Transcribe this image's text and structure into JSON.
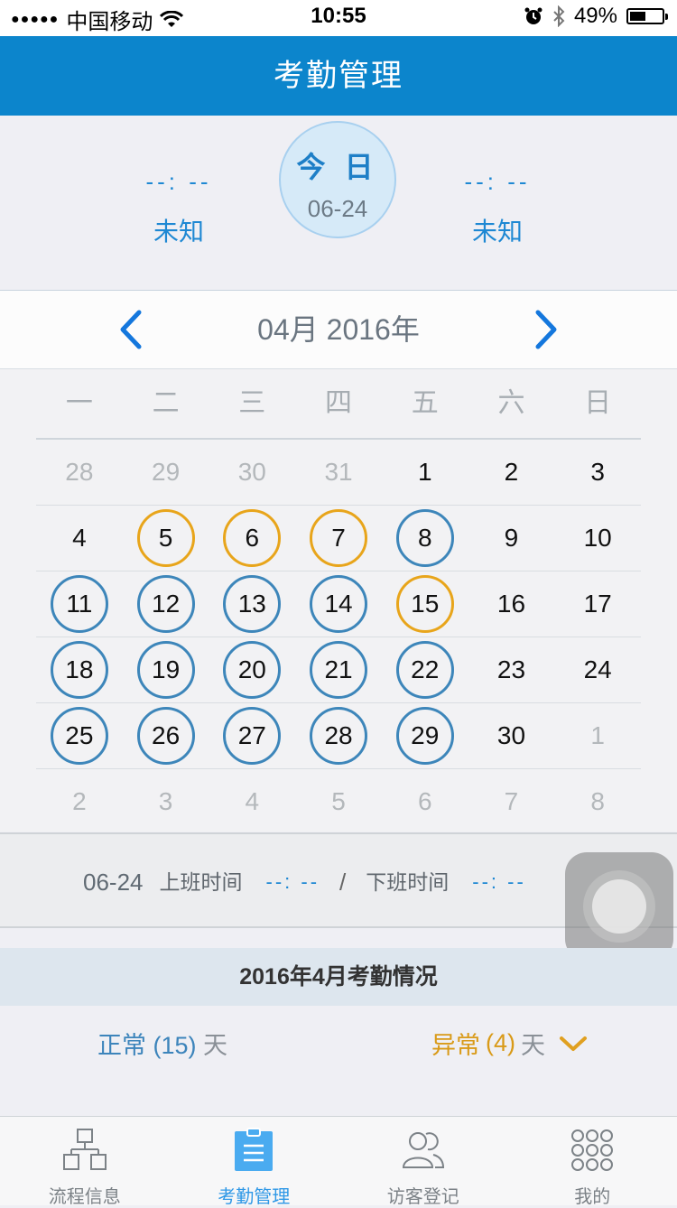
{
  "status_bar": {
    "signal_dots": "●●●●●",
    "carrier": "中国移动",
    "time": "10:55",
    "battery_percent": "49%",
    "battery_level": 0.49
  },
  "nav": {
    "title": "考勤管理"
  },
  "today_panel": {
    "left_time": "--: --",
    "left_status": "未知",
    "today_label": "今 日",
    "today_date": "06-24",
    "right_time": "--: --",
    "right_status": "未知"
  },
  "month_header": {
    "title": "04月 2016年"
  },
  "calendar": {
    "weekdays": [
      "一",
      "二",
      "三",
      "四",
      "五",
      "六",
      "日"
    ],
    "weeks": [
      [
        {
          "d": "28",
          "m": "other"
        },
        {
          "d": "29",
          "m": "other"
        },
        {
          "d": "30",
          "m": "other"
        },
        {
          "d": "31",
          "m": "other"
        },
        {
          "d": "1",
          "m": "cur"
        },
        {
          "d": "2",
          "m": "cur"
        },
        {
          "d": "3",
          "m": "cur"
        }
      ],
      [
        {
          "d": "4",
          "m": "cur"
        },
        {
          "d": "5",
          "m": "cur",
          "s": "abnormal"
        },
        {
          "d": "6",
          "m": "cur",
          "s": "abnormal"
        },
        {
          "d": "7",
          "m": "cur",
          "s": "abnormal"
        },
        {
          "d": "8",
          "m": "cur",
          "s": "normal"
        },
        {
          "d": "9",
          "m": "cur"
        },
        {
          "d": "10",
          "m": "cur"
        }
      ],
      [
        {
          "d": "11",
          "m": "cur",
          "s": "normal"
        },
        {
          "d": "12",
          "m": "cur",
          "s": "normal"
        },
        {
          "d": "13",
          "m": "cur",
          "s": "normal"
        },
        {
          "d": "14",
          "m": "cur",
          "s": "normal"
        },
        {
          "d": "15",
          "m": "cur",
          "s": "abnormal"
        },
        {
          "d": "16",
          "m": "cur"
        },
        {
          "d": "17",
          "m": "cur"
        }
      ],
      [
        {
          "d": "18",
          "m": "cur",
          "s": "normal"
        },
        {
          "d": "19",
          "m": "cur",
          "s": "normal"
        },
        {
          "d": "20",
          "m": "cur",
          "s": "normal"
        },
        {
          "d": "21",
          "m": "cur",
          "s": "normal"
        },
        {
          "d": "22",
          "m": "cur",
          "s": "normal"
        },
        {
          "d": "23",
          "m": "cur"
        },
        {
          "d": "24",
          "m": "cur"
        }
      ],
      [
        {
          "d": "25",
          "m": "cur",
          "s": "normal"
        },
        {
          "d": "26",
          "m": "cur",
          "s": "normal"
        },
        {
          "d": "27",
          "m": "cur",
          "s": "normal"
        },
        {
          "d": "28",
          "m": "cur",
          "s": "normal"
        },
        {
          "d": "29",
          "m": "cur",
          "s": "normal"
        },
        {
          "d": "30",
          "m": "cur"
        },
        {
          "d": "1",
          "m": "other"
        }
      ],
      [
        {
          "d": "2",
          "m": "other"
        },
        {
          "d": "3",
          "m": "other"
        },
        {
          "d": "4",
          "m": "other"
        },
        {
          "d": "5",
          "m": "other"
        },
        {
          "d": "6",
          "m": "other"
        },
        {
          "d": "7",
          "m": "other"
        },
        {
          "d": "8",
          "m": "other"
        }
      ]
    ]
  },
  "day_detail": {
    "date": "06-24",
    "checkin_label": "上班时间",
    "checkin_value": "--: --",
    "separator": "/",
    "checkout_label": "下班时间",
    "checkout_value": "--: --"
  },
  "summary": {
    "title": "2016年4月考勤情况",
    "normal_label": "正常",
    "normal_count": "(15)",
    "abnormal_label": "异常",
    "abnormal_count": "(4)",
    "unit": "天"
  },
  "tabs": [
    {
      "label": "流程信息",
      "icon": "flowchart-icon"
    },
    {
      "label": "考勤管理",
      "icon": "clipboard-icon",
      "active": true
    },
    {
      "label": "访客登记",
      "icon": "visitors-icon"
    },
    {
      "label": "我的",
      "icon": "grid-dots-icon"
    }
  ],
  "colors": {
    "nav_blue": "#0c85cc",
    "normal_ring": "#3d86ba",
    "abnormal_ring": "#e8a51b",
    "accent_text": "#1e88d3",
    "tab_active": "#2f98e6"
  }
}
